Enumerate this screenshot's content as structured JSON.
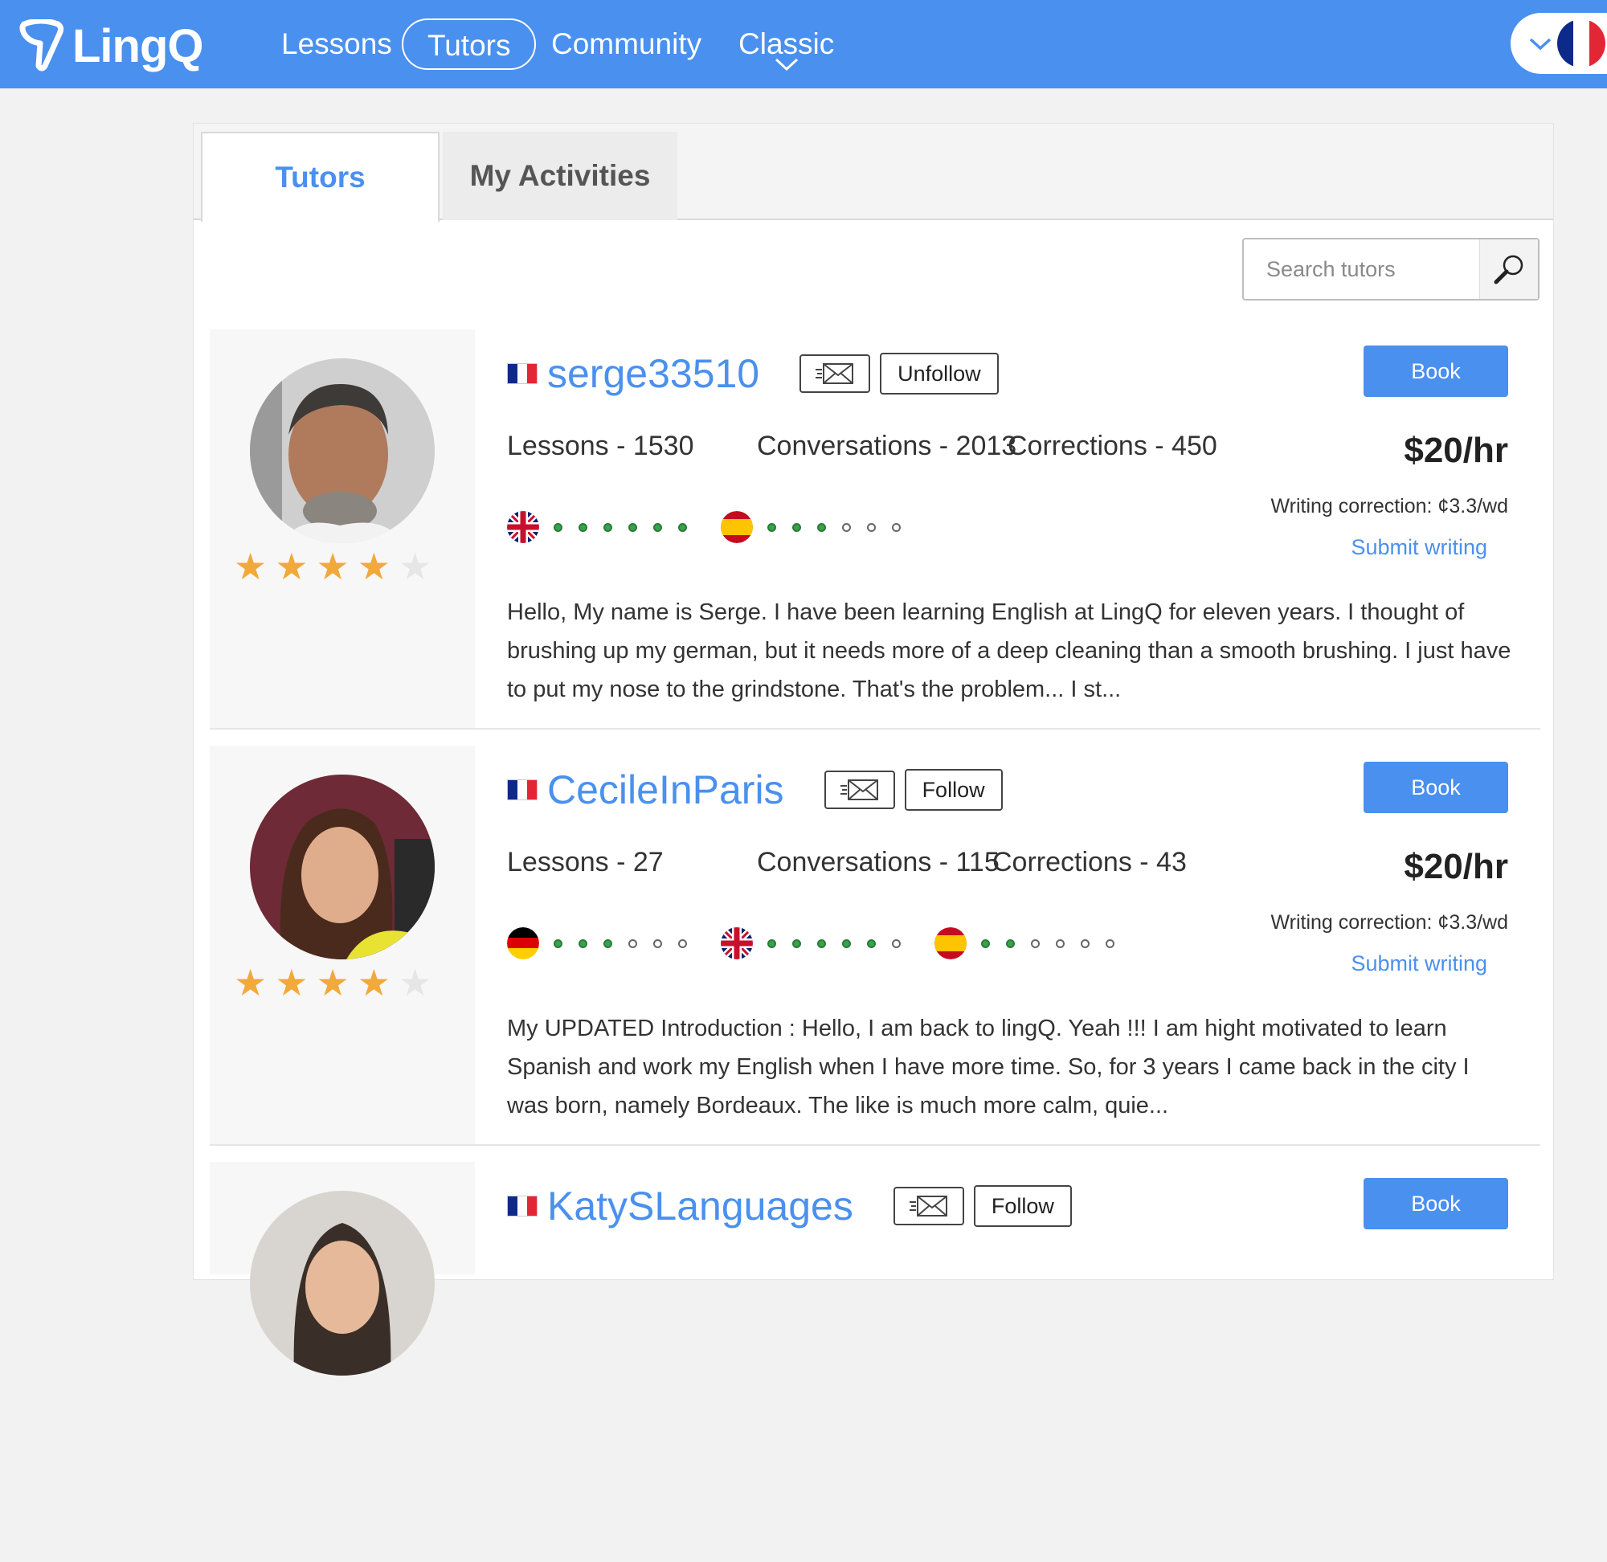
{
  "header": {
    "logo_text": "LingQ",
    "nav": [
      {
        "label": "Lessons",
        "active": false
      },
      {
        "label": "Tutors",
        "active": true
      },
      {
        "label": "Community",
        "active": false
      },
      {
        "label": "Classic",
        "active": false
      }
    ],
    "language_flag_icon": "france-flag-icon"
  },
  "tabs": [
    {
      "label": "Tutors",
      "active": true
    },
    {
      "label": "My Activities",
      "active": false
    }
  ],
  "search": {
    "placeholder": "Search tutors",
    "icon": "search-icon"
  },
  "colors": {
    "brand": "#4a90ee",
    "star": "#f2a93b",
    "level_on": "#3aa24b"
  },
  "tutors": [
    {
      "name": "serge33510",
      "follow_label": "Unfollow",
      "book_label": "Book",
      "rating": 4,
      "lessons": "Lessons - 1530",
      "conversations": "Conversations - 2013",
      "corrections": "Corrections - 450",
      "price": "$20/hr",
      "writing_correction": "Writing correction: ¢3.3/wd",
      "submit_label": "Submit writing",
      "languages": [
        {
          "language": "English",
          "flag": "uk-flag-icon",
          "level": 6
        },
        {
          "language": "Spanish",
          "flag": "spain-flag-icon",
          "level": 3
        }
      ],
      "bio": "Hello, My name is Serge. I have been learning English at LingQ for eleven years. I thought of brushing up my german, but it needs more of a deep cleaning than a smooth brushing. I just have to put my nose to the grindstone. That's the problem... I st..."
    },
    {
      "name": "CecileInParis",
      "follow_label": "Follow",
      "book_label": "Book",
      "rating": 4,
      "lessons": "Lessons - 27",
      "conversations": "Conversations - 115",
      "corrections": "Corrections - 43",
      "price": "$20/hr",
      "writing_correction": "Writing correction: ¢3.3/wd",
      "submit_label": "Submit writing",
      "languages": [
        {
          "language": "German",
          "flag": "germany-flag-icon",
          "level": 3
        },
        {
          "language": "English",
          "flag": "uk-flag-icon",
          "level": 5
        },
        {
          "language": "Spanish",
          "flag": "spain-flag-icon",
          "level": 2
        }
      ],
      "bio": "My UPDATED Introduction : Hello, I am back to lingQ. Yeah !!! I am hight motivated to learn Spanish and work my English when I have more time. So, for 3 years I came back in the city  I was born, namely Bordeaux. The like is much more calm, quie..."
    },
    {
      "name": "KatySLanguages",
      "follow_label": "Follow",
      "book_label": "Book"
    }
  ]
}
